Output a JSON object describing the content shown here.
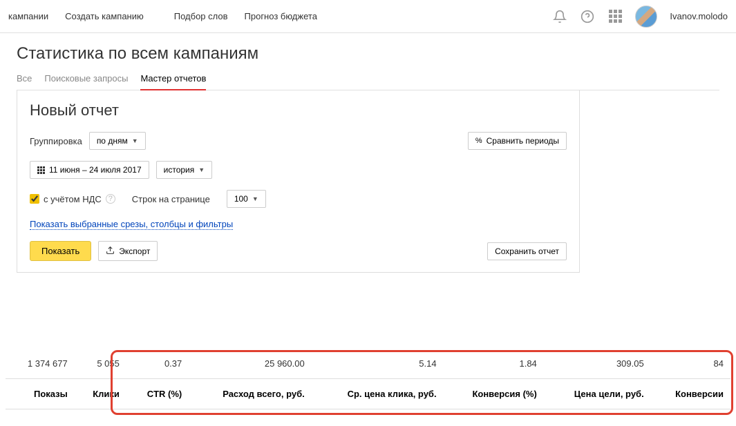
{
  "topnav": {
    "campaigns": "кампании",
    "create": "Создать кампанию",
    "keywords": "Подбор слов",
    "forecast": "Прогноз бюджета"
  },
  "user": {
    "name": "Ivanov.molodo"
  },
  "page_title": "Статистика по всем кампаниям",
  "tabs": {
    "all": "Все",
    "search": "Поисковые запросы",
    "wizard": "Мастер отчетов"
  },
  "panel": {
    "title": "Новый отчет",
    "group_label": "Группировка",
    "group_value": "по дням",
    "date_range": "11 июня – 24 июля 2017",
    "history": "история",
    "vat_label": "с учётом НДС",
    "rows_label": "Строк на странице",
    "rows_value": "100",
    "filters_link": "Показать выбранные срезы, столбцы и фильтры",
    "compare": "Сравнить периоды",
    "show": "Показать",
    "export": "Экспорт",
    "save": "Сохранить отчет"
  },
  "table": {
    "headers": {
      "impressions": "Показы",
      "clicks": "Клики",
      "ctr": "CTR (%)",
      "spend": "Расход всего, руб.",
      "cpc": "Ср. цена клика, руб.",
      "conv_rate": "Конверсия (%)",
      "goal_cost": "Цена цели, руб.",
      "conversions": "Конверсии"
    },
    "values": {
      "impressions": "1 374 677",
      "clicks": "5 055",
      "ctr": "0.37",
      "spend": "25 960.00",
      "cpc": "5.14",
      "conv_rate": "1.84",
      "goal_cost": "309.05",
      "conversions": "84"
    }
  }
}
